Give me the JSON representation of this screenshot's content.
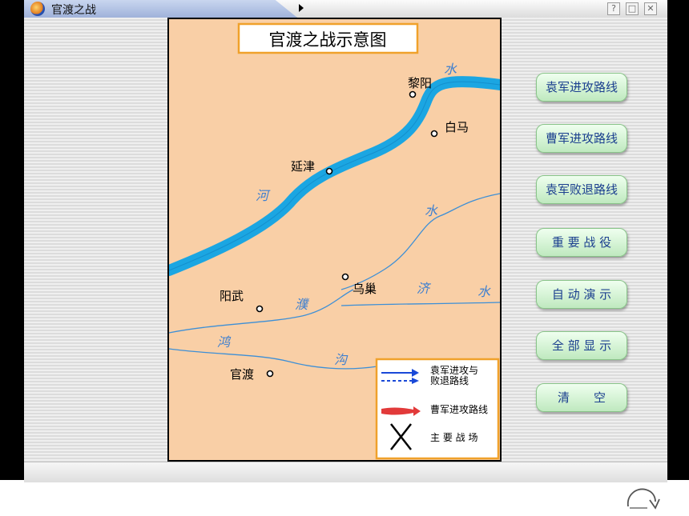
{
  "window": {
    "title": "官渡之战"
  },
  "map": {
    "title": "官渡之战示意图",
    "places": {
      "liyang": "黎阳",
      "baima": "白马",
      "yanjin": "延津",
      "wuchao": "乌巢",
      "yangwu": "阳武",
      "guandu": "官渡"
    },
    "rivers": {
      "he_1": "水",
      "he_2": "河",
      "ji_1": "水",
      "ji_2": "济",
      "ji_3": "水",
      "pu": "濮",
      "hong": "鸿",
      "gou": "沟"
    },
    "legend": {
      "yuan_route": "袁军进攻与败退路线",
      "cao_route": "曹军进攻路线",
      "battlefield": "主 要 战 场"
    }
  },
  "buttons": {
    "yuan_attack": "袁军进攻路线",
    "cao_attack": "曹军进攻路线",
    "yuan_retreat": "袁军败退路线",
    "battles": "重 要 战 役",
    "auto_demo": "自 动 演 示",
    "show_all": "全 部 显 示",
    "clear": "清　　空"
  },
  "colors": {
    "map_bg": "#f9cfa6",
    "river_main": "#1ba6e2",
    "river_thin": "#3d8fd6",
    "frame": "#f0a12b",
    "button_text": "#1b3f8f"
  }
}
